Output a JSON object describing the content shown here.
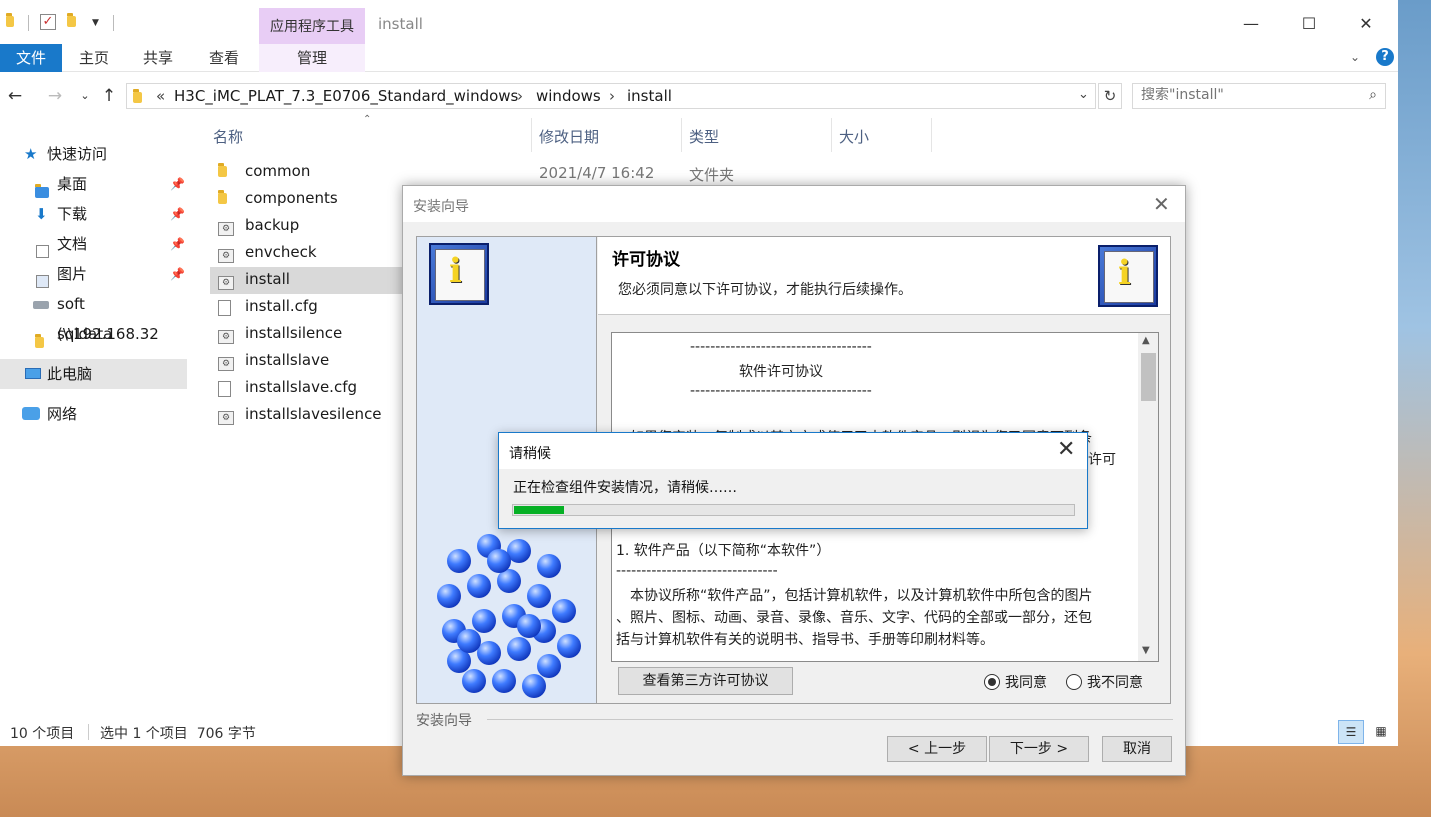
{
  "explorer": {
    "window_title": "install",
    "context_tab_header": "应用程序工具",
    "ribbon_tabs": {
      "file": "文件",
      "home": "主页",
      "share": "共享",
      "view": "查看",
      "manage": "管理"
    },
    "address": {
      "overflow": "«",
      "crumbs": [
        "H3C_iMC_PLAT_7.3_E0706_Standard_windows",
        "windows",
        "install"
      ]
    },
    "search": {
      "placeholder": "搜索\"install\""
    },
    "sidebar": {
      "quick_access": "快速访问",
      "items": [
        "桌面",
        "下载",
        "文档",
        "图片",
        "soft (\\\\192.168.32",
        "sqldata"
      ],
      "this_pc": "此电脑",
      "network": "网络"
    },
    "columns": {
      "name": "名称",
      "modified": "修改日期",
      "type": "类型",
      "size": "大小"
    },
    "files": [
      "common",
      "components",
      "backup",
      "envcheck",
      "install",
      "install.cfg",
      "installsilence",
      "installslave",
      "installslave.cfg",
      "installslavesilence"
    ],
    "first_row_meta": {
      "modified": "2021/4/7 16:42",
      "type": "文件夹"
    },
    "status": {
      "count": "10 个项目",
      "selected": "选中 1 个项目  706 字节"
    }
  },
  "wizard": {
    "title": "安装向导",
    "header_title": "许可协议",
    "header_subtitle": "您必须同意以下许可协议，才能执行后续操作。",
    "license_lines": [
      "------------------------------------",
      "软件许可协议",
      "------------------------------------",
      "如果您安装、复制或以其它方式使用了本软件产品，则视为您已同意下列条",
      "许可",
      "1. 软件产品（以下简称“本软件”）",
      "--------------------------------",
      "本协议所称“软件产品”，包括计算机软件，以及计算机软件中所包含的图片",
      "、照片、图标、动画、录音、录像、音乐、文字、代码的全部或一部分，还包",
      "括与计算机软件有关的说明书、指导书、手册等印刷材料等。"
    ],
    "third_party_button": "查看第三方许可协议",
    "agree": "我同意",
    "disagree": "我不同意",
    "agree_selected": true,
    "footer_label": "安装向导",
    "back": "< 上一步",
    "next": "下一步 >",
    "cancel": "取消"
  },
  "wait_dialog": {
    "title": "请稍候",
    "message": "正在检查组件安装情况，请稍候……",
    "progress_fraction": 0.09,
    "progress_color": "#06b025"
  }
}
